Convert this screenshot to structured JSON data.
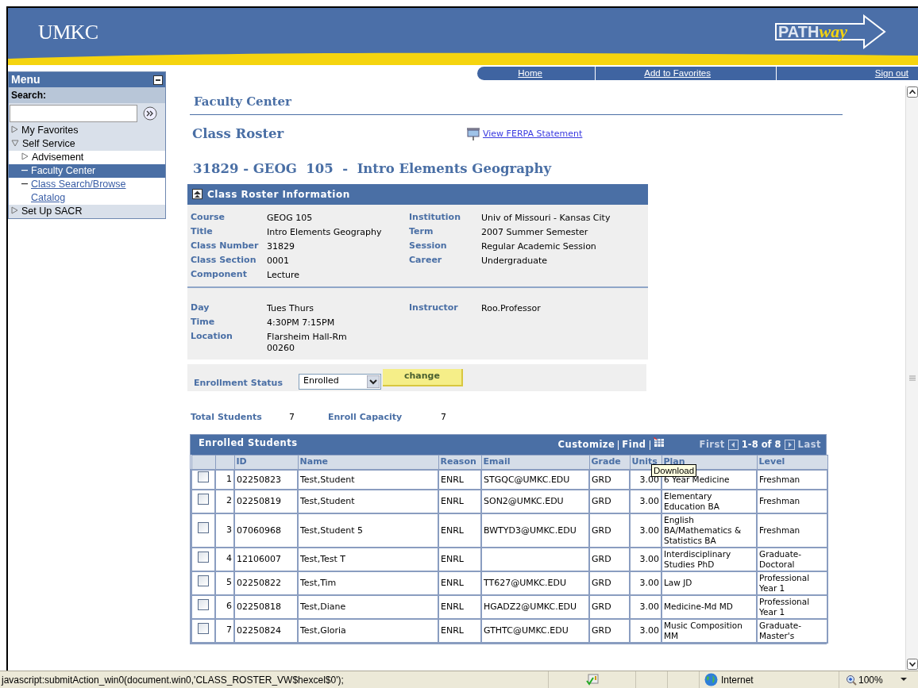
{
  "header": {
    "logo": "UMKC",
    "brand": "PATH",
    "brand_script": "way"
  },
  "nav_links": [
    "Home",
    "Add to Favorites",
    "Sign out"
  ],
  "menu": {
    "title": "Menu",
    "search_label": "Search:",
    "items": [
      {
        "label": "My Favorites",
        "kind": "folder",
        "expanded": false,
        "selected": false
      },
      {
        "label": "Self Service",
        "kind": "folder",
        "expanded": true,
        "selected": false,
        "children": [
          {
            "label": "Advisement",
            "kind": "folder",
            "expanded": false,
            "selected": false
          },
          {
            "label": "Faculty Center",
            "kind": "link",
            "selected": true
          },
          {
            "label": "Class Search/Browse Catalog",
            "kind": "link",
            "selected": false
          }
        ]
      },
      {
        "label": "Set Up SACR",
        "kind": "folder",
        "expanded": false,
        "selected": false
      }
    ]
  },
  "page_title": "Faculty Center",
  "section_title": "Class Roster",
  "ferpa_link": "View FERPA Statement",
  "class_heading": "31829 - GEOG  105  -  Intro Elements Geography",
  "info_panel": {
    "title": "Class Roster Information",
    "expanded": true,
    "details_left": [
      {
        "label": "Course",
        "value": "GEOG  105"
      },
      {
        "label": "Title",
        "value": "Intro Elements Geography"
      },
      {
        "label": "Class Number",
        "value": "31829"
      },
      {
        "label": "Class Section",
        "value": "0001"
      },
      {
        "label": "Component",
        "value": "Lecture"
      }
    ],
    "details_right": [
      {
        "label": "Institution",
        "value": "Univ of Missouri - Kansas City"
      },
      {
        "label": "Term",
        "value": "2007 Summer Semester"
      },
      {
        "label": "Session",
        "value": "Regular Academic Session"
      },
      {
        "label": "Career",
        "value": "Undergraduate"
      }
    ],
    "schedule_left": [
      {
        "label": "Day",
        "value": "Tues  Thurs"
      },
      {
        "label": "Time",
        "value": "4:30PM   7:15PM"
      },
      {
        "label": "Location",
        "value": "Flarsheim Hall-Rm\n00260"
      }
    ],
    "schedule_right": [
      {
        "label": "Instructor",
        "value": "Roo.Professor"
      }
    ]
  },
  "enrollment_status": {
    "label": "Enrollment Status",
    "value": "Enrolled",
    "button": "change"
  },
  "totals": [
    {
      "label": "Total Students",
      "value": "7"
    },
    {
      "label": "Enroll Capacity",
      "value": "7"
    }
  ],
  "table": {
    "title": "Enrolled Students",
    "tools": [
      "Customize",
      "Find"
    ],
    "pager": {
      "first": "First",
      "range": "1-8 of 8",
      "last": "Last"
    },
    "columns": [
      "ID",
      "Name",
      "Reason",
      "Email",
      "Grade",
      "Units",
      "Plan",
      "Level"
    ],
    "rows": [
      {
        "checked": false,
        "number": "1",
        "id": "02250823",
        "name": "Test,Student",
        "reason": "ENRL",
        "email": "STGQC@UMKC.EDU",
        "grade": "GRD",
        "units": "3.00",
        "plan": "6 Year Medicine",
        "level": "Freshman"
      },
      {
        "checked": false,
        "number": "2",
        "id": "02250819",
        "name": "Test,Student",
        "reason": "ENRL",
        "email": "SON2@UMKC.EDU",
        "grade": "GRD",
        "units": "3.00",
        "plan": "Elementary Education BA",
        "level": "Freshman"
      },
      {
        "checked": false,
        "number": "3",
        "id": "07060968",
        "name": "Test,Student 5",
        "reason": "ENRL",
        "email": "BWTYD3@UMKC.EDU",
        "grade": "GRD",
        "units": "3.00",
        "plan": "English BA/Mathematics & Statistics BA",
        "level": "Freshman"
      },
      {
        "checked": false,
        "number": "4",
        "id": "12106007",
        "name": "Test,Test T",
        "reason": "ENRL",
        "grade": "GRD",
        "units": "3.00",
        "plan": "Interdisciplinary Studies PhD",
        "level": "Graduate-Doctoral"
      },
      {
        "checked": false,
        "number": "5",
        "id": "02250822",
        "name": "Test,Tim",
        "reason": "ENRL",
        "email": "TT627@UMKC.EDU",
        "grade": "GRD",
        "units": "3.00",
        "plan": "Law JD",
        "level": "Professional Year 1"
      },
      {
        "checked": false,
        "number": "6",
        "id": "02250818",
        "name": "Test,Diane",
        "reason": "ENRL",
        "email": "HGADZ2@UMKC.EDU",
        "grade": "GRD",
        "units": "3.00",
        "plan": "Medicine-Md MD",
        "level": "Professional Year 1"
      },
      {
        "checked": false,
        "number": "7",
        "id": "02250824",
        "name": "Test,Gloria",
        "reason": "ENRL",
        "email": "GTHTC@UMKC.EDU",
        "grade": "GRD",
        "units": "3.00",
        "plan": "Music Composition MM",
        "level": "Graduate-Master's"
      }
    ]
  },
  "tooltip": "Download",
  "status_bar": {
    "url": "javascript:submitAction_win0(document.win0,'CLASS_ROSTER_VW$hexcel$0');",
    "zone": "Internet",
    "zoom": "100%"
  }
}
